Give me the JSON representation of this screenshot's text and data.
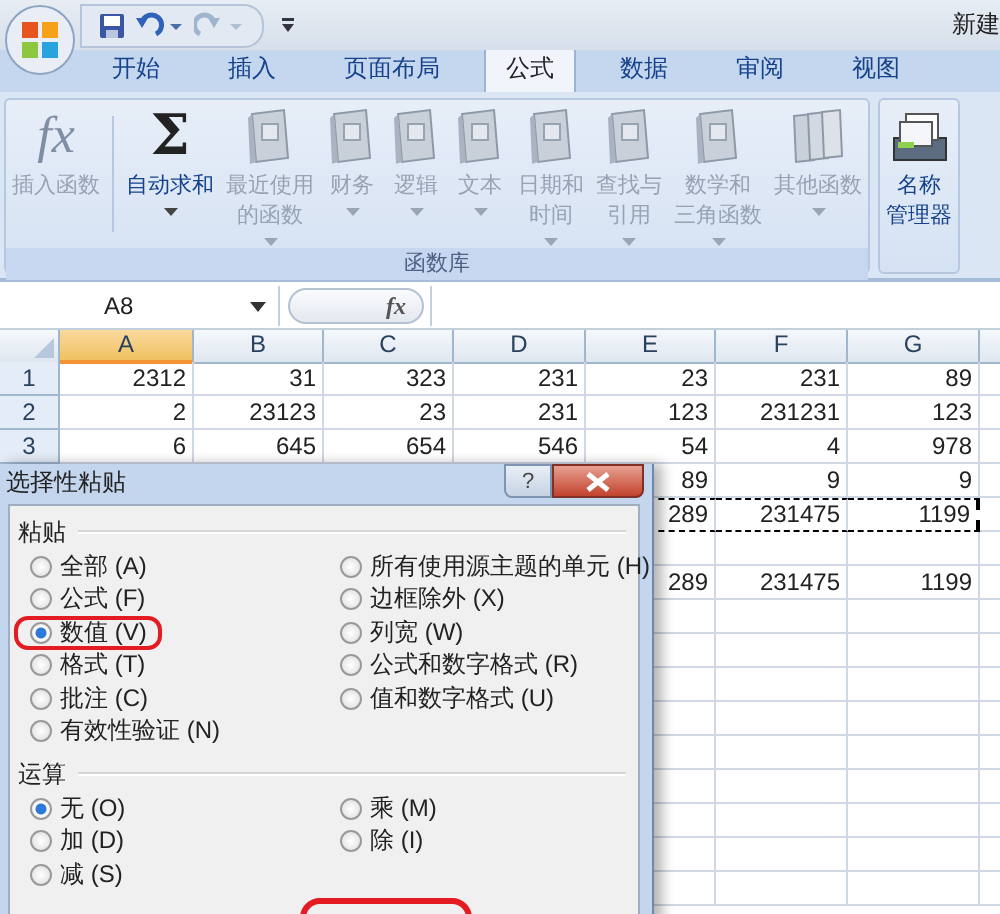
{
  "title_bar": {
    "document_title": "新建"
  },
  "tabs": [
    {
      "label": "开始",
      "selected": false
    },
    {
      "label": "插入",
      "selected": false
    },
    {
      "label": "页面布局",
      "selected": false
    },
    {
      "label": "公式",
      "selected": true
    },
    {
      "label": "数据",
      "selected": false
    },
    {
      "label": "审阅",
      "selected": false
    },
    {
      "label": "视图",
      "selected": false
    }
  ],
  "ribbon": {
    "groups": [
      {
        "label": "函数库",
        "items": [
          {
            "kind": "fx",
            "icon_text": "fx",
            "lines": [
              "插入函数"
            ],
            "disabled": true,
            "dropdown": false
          },
          {
            "kind": "sum",
            "icon_text": "Σ",
            "lines": [
              "自动求和"
            ],
            "disabled": false,
            "dropdown": true
          },
          {
            "kind": "book",
            "lines": [
              "最近使用",
              "的函数"
            ],
            "disabled": true,
            "dropdown": true
          },
          {
            "kind": "book",
            "lines": [
              "财务"
            ],
            "disabled": true,
            "dropdown": true
          },
          {
            "kind": "book",
            "lines": [
              "逻辑"
            ],
            "disabled": true,
            "dropdown": true
          },
          {
            "kind": "book",
            "lines": [
              "文本"
            ],
            "disabled": true,
            "dropdown": true
          },
          {
            "kind": "book",
            "lines": [
              "日期和",
              "时间"
            ],
            "disabled": true,
            "dropdown": true
          },
          {
            "kind": "book",
            "lines": [
              "查找与",
              "引用"
            ],
            "disabled": true,
            "dropdown": true
          },
          {
            "kind": "book",
            "lines": [
              "数学和",
              "三角函数"
            ],
            "disabled": true,
            "dropdown": true
          },
          {
            "kind": "books",
            "lines": [
              "其他函数"
            ],
            "disabled": true,
            "dropdown": true
          }
        ]
      },
      {
        "items": [
          {
            "kind": "name_manager",
            "lines": [
              "名称",
              "管理器"
            ],
            "disabled": false,
            "dropdown": false
          }
        ]
      }
    ]
  },
  "formula_bar": {
    "name_box": "A8",
    "function_button": "fx"
  },
  "sheet": {
    "columns": [
      {
        "label": "A",
        "selected": true
      },
      {
        "label": "B",
        "selected": false
      },
      {
        "label": "C",
        "selected": false
      },
      {
        "label": "D",
        "selected": false
      },
      {
        "label": "E",
        "selected": false
      },
      {
        "label": "F",
        "selected": false
      },
      {
        "label": "G",
        "selected": false
      }
    ],
    "rows": [
      {
        "header": "1",
        "marquee": false,
        "values": [
          "2312",
          "31",
          "323",
          "231",
          "23",
          "231",
          "89"
        ]
      },
      {
        "header": "2",
        "marquee": false,
        "values": [
          "2",
          "23123",
          "23",
          "231",
          "123",
          "231231",
          "123"
        ]
      },
      {
        "header": "3",
        "marquee": false,
        "values": [
          "6",
          "645",
          "654",
          "546",
          "54",
          "4",
          "978"
        ]
      },
      {
        "marquee": false,
        "values": [
          "89",
          "9",
          "9"
        ]
      },
      {
        "marquee": true,
        "values": [
          "289",
          "231475",
          "1199"
        ]
      },
      {
        "marquee": false
      },
      {
        "marquee": false,
        "values": [
          "289",
          "231475",
          "1199"
        ]
      }
    ]
  },
  "dialog": {
    "title": "选择性粘贴",
    "help_label": "?",
    "footer_circled": true,
    "sections": [
      {
        "label": "粘贴",
        "options": [
          {
            "label": "全部 (A)",
            "selected": false,
            "circled": false
          },
          {
            "label": "公式 (F)",
            "selected": false,
            "circled": false
          },
          {
            "label": "数值 (V)",
            "selected": true,
            "circled": true
          },
          {
            "label": "格式 (T)",
            "selected": false,
            "circled": false
          },
          {
            "label": "批注 (C)",
            "selected": false,
            "circled": false
          },
          {
            "label": "有效性验证 (N)",
            "selected": false,
            "circled": false
          },
          {
            "label": "所有使用源主题的单元 (H)",
            "selected": false,
            "circled": false
          },
          {
            "label": "边框除外 (X)",
            "selected": false,
            "circled": false
          },
          {
            "label": "列宽 (W)",
            "selected": false,
            "circled": false
          },
          {
            "label": "公式和数字格式 (R)",
            "selected": false,
            "circled": false
          },
          {
            "label": "值和数字格式 (U)",
            "selected": false,
            "circled": false
          }
        ]
      },
      {
        "label": "运算",
        "options": [
          {
            "label": "无 (O)",
            "selected": true,
            "circled": false
          },
          {
            "label": "加 (D)",
            "selected": false,
            "circled": false
          },
          {
            "label": "减 (S)",
            "selected": false,
            "circled": false
          },
          {
            "label": "乘 (M)",
            "selected": false,
            "circled": false
          },
          {
            "label": "除 (I)",
            "selected": false,
            "circled": false
          }
        ]
      }
    ]
  }
}
